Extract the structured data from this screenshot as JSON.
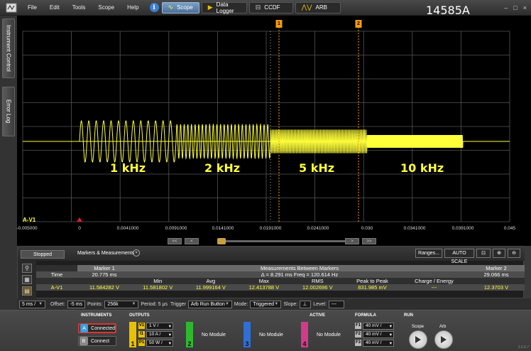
{
  "window": {
    "id_label": "14585A",
    "controls": [
      "–",
      "□",
      "×"
    ]
  },
  "menu": {
    "items": [
      "File",
      "Edit",
      "Tools",
      "Scope",
      "Help"
    ]
  },
  "tabs": [
    {
      "label": "Scope",
      "icon": "sine-wave-icon",
      "active": true
    },
    {
      "label": "Data Logger",
      "icon": "play-arrow-icon",
      "active": false
    },
    {
      "label": "CCDF",
      "icon": "ccdf-icon",
      "active": false
    },
    {
      "label": "ARB",
      "icon": "arb-wave-icon",
      "active": false
    }
  ],
  "side_tabs": [
    "Instrument Control",
    "Error Log"
  ],
  "scope": {
    "channel_label": "A-V1",
    "x_ticks": [
      "-0.005000",
      "0",
      "0.0041000",
      "0.0091000",
      "0.0141000",
      "0.0191000",
      "0.0241000",
      "0.030",
      "0.0341000",
      "0.0391000",
      "0.045"
    ],
    "frequency_labels": [
      "1 kHz",
      "2 kHz",
      "5 kHz",
      "10 kHz"
    ],
    "markers": [
      "1",
      "2"
    ],
    "trace_color": "#ffff3a",
    "marker_color": "#f39c12"
  },
  "scroll": {
    "left_fast": "<<",
    "left": "<",
    "right": ">",
    "right_fast": ">>"
  },
  "measurements": {
    "status": "Stopped",
    "title": "Markers & Measurements",
    "ranges_button": "Ranges...",
    "autoscale_button": "AUTO SCALE",
    "marker1_header": "Marker 1",
    "marker2_header": "Marker 2",
    "between_header": "Measurements Between Markers",
    "time_label": "Time",
    "marker1_time": "20.775 ms",
    "delta_text": "Δ = 8.291 ms   Freq = 120.614 Hz",
    "marker2_time": "29.066 ms",
    "columns": [
      "Min",
      "Avg",
      "Max",
      "RMS",
      "Peak to Peak",
      "Charge / Energy"
    ],
    "channel": "A-V1",
    "marker1_value": "11.584282 V",
    "values": [
      "11.581802 V",
      "11.999164 V",
      "12.413788 V",
      "12.002696 V",
      "831.985 mV",
      "---"
    ],
    "marker2_value": "12.3703 V"
  },
  "controls": {
    "timebase": "5 ms /",
    "offset_label": "Offset:",
    "offset_value": "-5 ms",
    "points_label": "Points:",
    "points_value": "256k",
    "period_label": "Period:",
    "period_value": "5 μs",
    "trigger_label": "Trigger",
    "trigger_value": "Arb Run Button",
    "mode_label": "Mode:",
    "mode_value": "Triggered",
    "slope_label": "Slope:",
    "level_label": "Level:",
    "level_value": "---"
  },
  "instruments": {
    "section_label": "INSTRUMENTS",
    "a_badge": "A",
    "a_label": "Connected",
    "b_badge": "B",
    "b_label": "Connect"
  },
  "outputs": {
    "section_label": "OUTPUTS",
    "module1": {
      "number": "1",
      "rows": [
        {
          "tag": "V1",
          "value": "1 V /"
        },
        {
          "tag": "I1",
          "value": "10 A /"
        },
        {
          "tag": "P1",
          "value": "50 W /"
        }
      ],
      "color": "#e8c000"
    },
    "module2": {
      "number": "2",
      "label": "No Module",
      "color": "#2eb82e"
    },
    "module3": {
      "number": "3",
      "label": "No Module",
      "color": "#2f6fd6"
    },
    "module4": {
      "number": "4",
      "label": "No Module",
      "color": "#d23a8a"
    },
    "active_label": "ACTIVE"
  },
  "formula": {
    "section_label": "FORMULA",
    "rows": [
      {
        "tag": "F1",
        "value": "40 mV /"
      },
      {
        "tag": "F2",
        "value": "40 mV /"
      },
      {
        "tag": "F3",
        "value": "40 mV /"
      }
    ]
  },
  "run": {
    "section_label": "RUN",
    "scope_label": "Scope",
    "arb_label": "Arb"
  },
  "version": "2.0.0.7"
}
